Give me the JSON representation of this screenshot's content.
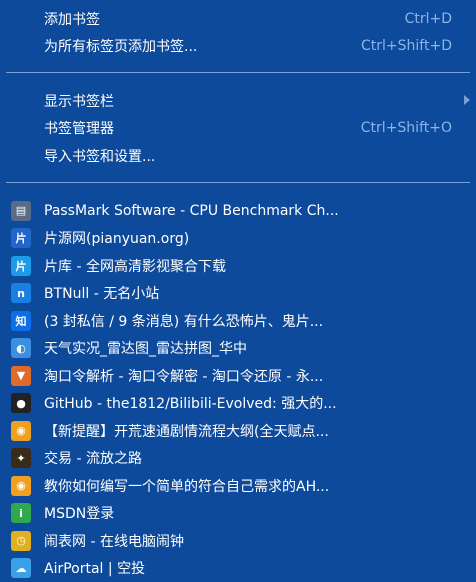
{
  "menu": {
    "add_bookmark": {
      "label": "添加书签",
      "shortcut": "Ctrl+D"
    },
    "bookmark_all_tabs": {
      "label": "为所有标签页添加书签...",
      "shortcut": "Ctrl+Shift+D"
    },
    "show_bookmarks_bar": {
      "label": "显示书签栏"
    },
    "bookmark_manager": {
      "label": "书签管理器",
      "shortcut": "Ctrl+Shift+O"
    },
    "import_bookmarks": {
      "label": "导入书签和设置..."
    }
  },
  "bookmarks": [
    {
      "label": "PassMark Software - CPU Benchmark Ch...",
      "icon": "passmark-icon",
      "color": "#5a6b86",
      "glyph": "▤"
    },
    {
      "label": "片源网(pianyuan.org)",
      "icon": "pianyuan-icon",
      "color": "#2266cc",
      "glyph": "片"
    },
    {
      "label": "片库 - 全网高清影视聚合下载",
      "icon": "pianku-icon",
      "color": "#1e9be6",
      "glyph": "片"
    },
    {
      "label": "BTNull - 无名小站",
      "icon": "btnull-icon",
      "color": "#1a7fe0",
      "glyph": "n"
    },
    {
      "label": "(3 封私信 / 9 条消息) 有什么恐怖片、鬼片...",
      "icon": "zhihu-icon",
      "color": "#0a6fe8",
      "glyph": "知"
    },
    {
      "label": "天气实况_雷达图_雷达拼图_华中",
      "icon": "weather-icon",
      "color": "#3a8fe0",
      "glyph": "◐"
    },
    {
      "label": "淘口令解析 - 淘口令解密 - 淘口令还原 - 永...",
      "icon": "shield-icon",
      "color": "#e06a2a",
      "glyph": "▼"
    },
    {
      "label": "GitHub - the1812/Bilibili-Evolved: 强大的...",
      "icon": "github-icon",
      "color": "#222222",
      "glyph": "●"
    },
    {
      "label": "【新提醒】开荒速通剧情流程大纲(全天赋点...",
      "icon": "eyes-icon",
      "color": "#f0a020",
      "glyph": "◉"
    },
    {
      "label": "交易 - 流放之路",
      "icon": "poe-icon",
      "color": "#3a2a18",
      "glyph": "✦"
    },
    {
      "label": "教你如何编写一个简单的符合自己需求的AH...",
      "icon": "eyes-icon",
      "color": "#f0a020",
      "glyph": "◉"
    },
    {
      "label": "MSDN登录",
      "icon": "msdn-icon",
      "color": "#2fa84f",
      "glyph": "i"
    },
    {
      "label": "闹表网 - 在线电脑闹钟",
      "icon": "alarm-icon",
      "color": "#e0b020",
      "glyph": "◷"
    },
    {
      "label": "AirPortal | 空投",
      "icon": "cloud-icon",
      "color": "#3aa0e8",
      "glyph": "☁"
    }
  ]
}
